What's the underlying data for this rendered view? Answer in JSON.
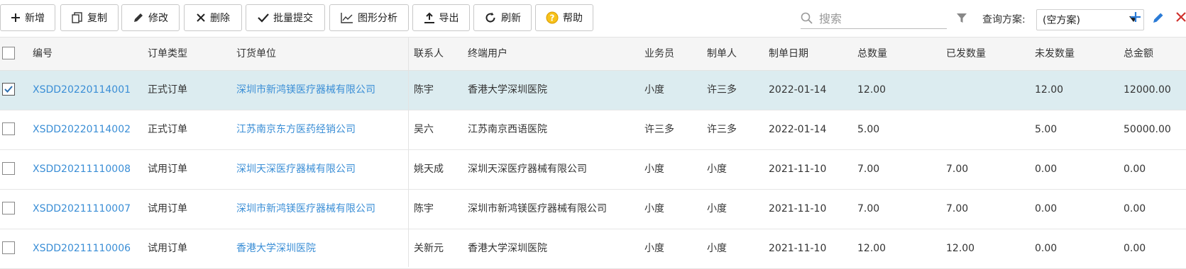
{
  "toolbar": {
    "buttons": [
      {
        "label": "新增",
        "icon": "plus-icon"
      },
      {
        "label": "复制",
        "icon": "copy-icon"
      },
      {
        "label": "修改",
        "icon": "pencil-icon"
      },
      {
        "label": "删除",
        "icon": "x-icon"
      },
      {
        "label": "批量提交",
        "icon": "check-icon"
      },
      {
        "label": "图形分析",
        "icon": "chart-icon"
      },
      {
        "label": "导出",
        "icon": "upload-icon"
      },
      {
        "label": "刷新",
        "icon": "refresh-icon"
      },
      {
        "label": "帮助",
        "icon": "help-icon"
      }
    ],
    "search_placeholder": "搜索",
    "scheme_label": "查询方案:",
    "scheme_value": "(空方案)",
    "colors": {
      "add": "#2b7bd6",
      "edit": "#2b7bd6",
      "delete": "#d0312d",
      "help": "#f0b400",
      "link": "#3a8ed6",
      "selected_row": "#dcecf0"
    }
  },
  "table": {
    "headers": [
      "编号",
      "订单类型",
      "订货单位",
      "联系人",
      "终端用户",
      "业务员",
      "制单人",
      "制单日期",
      "总数量",
      "已发数量",
      "未发数量",
      "总金额"
    ],
    "rows": [
      {
        "checked": true,
        "id": "XSDD20220114001",
        "type": "正式订单",
        "unit": "深圳市新鸿镁医疗器械有限公司",
        "contact": "陈宇",
        "end_user": "香港大学深圳医院",
        "salesman": "小度",
        "maker": "许三多",
        "date": "2022-01-14",
        "total_qty": "12.00",
        "shipped": "",
        "unshipped": "12.00",
        "amount": "12000.00"
      },
      {
        "checked": false,
        "id": "XSDD20220114002",
        "type": "正式订单",
        "unit": "江苏南京东方医药经销公司",
        "contact": "吴六",
        "end_user": "江苏南京西语医院",
        "salesman": "许三多",
        "maker": "许三多",
        "date": "2022-01-14",
        "total_qty": "5.00",
        "shipped": "",
        "unshipped": "5.00",
        "amount": "50000.00"
      },
      {
        "checked": false,
        "id": "XSDD20211110008",
        "type": "试用订单",
        "unit": "深圳天深医疗器械有限公司",
        "contact": "姚天成",
        "end_user": "深圳天深医疗器械有限公司",
        "salesman": "小度",
        "maker": "小度",
        "date": "2021-11-10",
        "total_qty": "7.00",
        "shipped": "7.00",
        "unshipped": "0.00",
        "amount": "0.00"
      },
      {
        "checked": false,
        "id": "XSDD20211110007",
        "type": "试用订单",
        "unit": "深圳市新鸿镁医疗器械有限公司",
        "contact": "陈宇",
        "end_user": "深圳市新鸿镁医疗器械有限公司",
        "salesman": "小度",
        "maker": "小度",
        "date": "2021-11-10",
        "total_qty": "7.00",
        "shipped": "7.00",
        "unshipped": "0.00",
        "amount": "0.00"
      },
      {
        "checked": false,
        "id": "XSDD20211110006",
        "type": "试用订单",
        "unit": "香港大学深圳医院",
        "contact": "关新元",
        "end_user": "香港大学深圳医院",
        "salesman": "小度",
        "maker": "小度",
        "date": "2021-11-10",
        "total_qty": "12.00",
        "shipped": "12.00",
        "unshipped": "0.00",
        "amount": "0.00"
      }
    ]
  }
}
